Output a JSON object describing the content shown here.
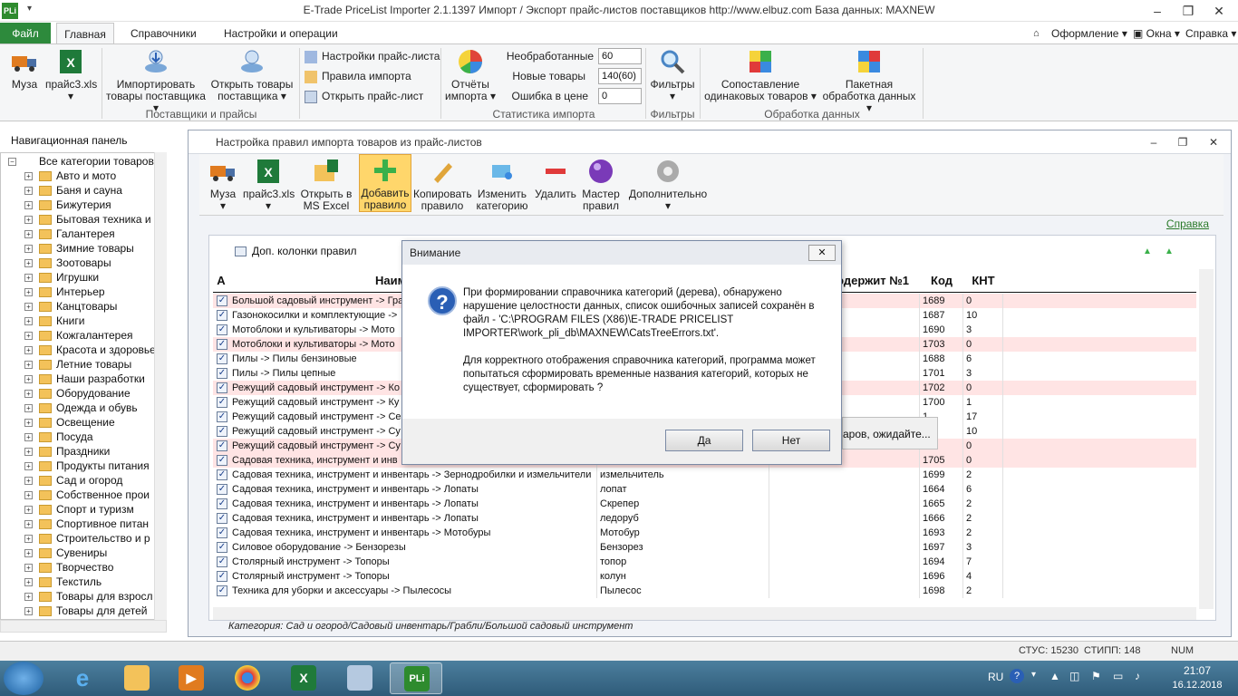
{
  "app": {
    "title": "E-Trade PriceList Importer 2.1.1397     Импорт / Экспорт прайс-листов поставщиков     http://www.elbuz.com     База данных: MAXNEW",
    "icon_label": "PLi"
  },
  "ribbon_tabs": [
    "Файл",
    "Главная",
    "Справочники",
    "Настройки и операции"
  ],
  "ribbon_right": [
    "Оформление",
    "Окна",
    "Справка"
  ],
  "ribbon": {
    "muza": "Муза",
    "prais": "прайс3.xls",
    "import_supplier": "Импортировать товары поставщика",
    "open_supplier": "Открыть товары поставщика",
    "group1": "Поставщики и прайсы",
    "settings_pricelist": "Настройки прайс-листа",
    "import_rules": "Правила импорта",
    "open_pricelist": "Открыть прайс-лист",
    "reports": "Отчёты импорта",
    "stat_unprocessed_label": "Необработанные",
    "stat_unprocessed_val": "60",
    "stat_new_label": "Новые товары",
    "stat_new_val": "140(60)",
    "stat_err_label": "Ошибка в цене",
    "stat_err_val": "0",
    "group2": "Статистика импорта",
    "filters": "Фильтры",
    "group3": "Фильтры",
    "compare": "Сопоставление одинаковых товаров",
    "batch": "Пакетная обработка данных",
    "group4": "Обработка данных"
  },
  "nav": {
    "header": "Навигационная панель",
    "root": "Все категории товаров",
    "items": [
      "Авто и мото",
      "Баня и сауна",
      "Бижутерия",
      "Бытовая техника и",
      "Галантерея",
      "Зимние товары",
      "Зоотовары",
      "Игрушки",
      "Интерьер",
      "Канцтовары",
      "Книги",
      "Кожгалантерея",
      "Красота и здоровье",
      "Летние товары",
      "Наши разработки",
      "Оборудование",
      "Одежда и обувь",
      "Освещение",
      "Посуда",
      "Праздники",
      "Продукты питания",
      "Сад и огород",
      "Собственное прои",
      "Спорт и туризм",
      "Спортивное питан",
      "Строительство и р",
      "Сувениры",
      "Творчество",
      "Текстиль",
      "Товары для взросл",
      "Товары для детей"
    ]
  },
  "inner": {
    "title": "Настройка правил импорта товаров из прайс-листов",
    "toolbar": [
      "Муза",
      "прайс3.xls",
      "Открыть в MS Excel",
      "Добавить правило",
      "Копировать правило",
      "Изменить категорию",
      "Удалить",
      "Мастер правил",
      "Дополнительно"
    ],
    "help": "Справка",
    "dop_columns": "Доп. колонки правил",
    "headers": {
      "a": "A",
      "name": "Наим. катего",
      "contains": "одержит №1",
      "code": "Код",
      "knt": "КНТ"
    },
    "rows": [
      {
        "name": "Большой садовый инструмент -> Гра",
        "c2": "",
        "code": "1689",
        "knt": "0",
        "pink": true
      },
      {
        "name": "Газонокосилки и комплектующие ->",
        "c2": "",
        "code": "1687",
        "knt": "10",
        "pink": false
      },
      {
        "name": "Мотоблоки и культиваторы -> Мото",
        "c2": "",
        "code": "1690",
        "knt": "3",
        "pink": false
      },
      {
        "name": "Мотоблоки и культиваторы -> Мото",
        "c2": "",
        "code": "1703",
        "knt": "0",
        "pink": true
      },
      {
        "name": "Пилы -> Пилы бензиновые",
        "c2": "",
        "code": "1688",
        "knt": "6",
        "pink": false
      },
      {
        "name": "Пилы -> Пилы цепные",
        "c2": "",
        "code": "1701",
        "knt": "3",
        "pink": false
      },
      {
        "name": "Режущий садовый инструмент -> Ко",
        "c2": "",
        "code": "1702",
        "knt": "0",
        "pink": true
      },
      {
        "name": "Режущий садовый инструмент -> Ку",
        "c2": "",
        "code": "1700",
        "knt": "1",
        "pink": false
      },
      {
        "name": "Режущий садовый инструмент -> Се",
        "c2": "",
        "code": "1",
        "knt": "17",
        "pink": false
      },
      {
        "name": "Режущий садовый инструмент -> Су",
        "c2": "",
        "code": "5",
        "knt": "10",
        "pink": false
      },
      {
        "name": "Режущий садовый инструмент -> Су",
        "c2": "",
        "code": "4",
        "knt": "0",
        "pink": true
      },
      {
        "name": "Садовая техника, инструмент и инв",
        "c2": "",
        "code": "1705",
        "knt": "0",
        "pink": true
      },
      {
        "name": "Садовая техника, инструмент и инвентарь -> Зернодробилки и измельчители",
        "c2": "измельчитель",
        "code": "1699",
        "knt": "2",
        "pink": false
      },
      {
        "name": "Садовая техника, инструмент и инвентарь -> Лопаты",
        "c2": "                лопат",
        "code": "1664",
        "knt": "6",
        "pink": false
      },
      {
        "name": "Садовая техника, инструмент и инвентарь -> Лопаты",
        "c2": "Скрепер",
        "code": "1665",
        "knt": "2",
        "pink": false
      },
      {
        "name": "Садовая техника, инструмент и инвентарь -> Лопаты",
        "c2": "ледоруб",
        "code": "1666",
        "knt": "2",
        "pink": false
      },
      {
        "name": "Садовая техника, инструмент и инвентарь -> Мотобуры",
        "c2": "Мотобур",
        "code": "1693",
        "knt": "2",
        "pink": false
      },
      {
        "name": "Силовое оборудование -> Бензорезы",
        "c2": "Бензорез",
        "code": "1697",
        "knt": "3",
        "pink": false
      },
      {
        "name": "Столярный инструмент -> Топоры",
        "c2": "топор",
        "code": "1694",
        "knt": "7",
        "pink": false
      },
      {
        "name": "Столярный инструмент -> Топоры",
        "c2": "колун",
        "code": "1696",
        "knt": "4",
        "pink": false
      },
      {
        "name": "Техника для уборки и аксессуары -> Пылесосы",
        "c2": "Пылесос",
        "code": "1698",
        "knt": "2",
        "pink": false
      }
    ],
    "category_status": "Категория: Сад и огород/Садовый инвентарь/Грабли/Большой садовый инструмент"
  },
  "dialog": {
    "title": "Внимание",
    "msg1": "При формировании справочника категорий (дерева), обнаружено нарушение целостности данных, список ошибочных записей сохранён в файл - 'C:\\PROGRAM FILES (X86)\\E-TRADE PRICELIST IMPORTER\\work_pli_db\\MAXNEW\\CatsTreeErrors.txt'.",
    "msg2": "Для корректного отображения справочника категорий, программа может попытаться сформировать временные названия категорий, которых не существует, сформировать ?",
    "yes": "Да",
    "no": "Нет",
    "waiting": "аров, ожидайте..."
  },
  "statusbar": {
    "stus": "СТУС: 15230",
    "stipp": "СТИПП: 148",
    "num": "NUM"
  },
  "taskbar": {
    "lang": "RU",
    "time": "21:07",
    "date": "16.12.2018"
  }
}
